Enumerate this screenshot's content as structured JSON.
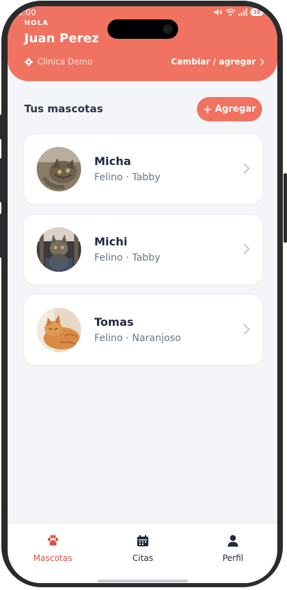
{
  "status": {
    "time": "3:00",
    "battery": "38"
  },
  "header": {
    "greeting": "HOLA",
    "user_name": "Juan Perez",
    "clinic_name": "Clinica Demo",
    "change_link": "Cambiar / agregar"
  },
  "section": {
    "title": "Tus mascotas",
    "add_button": "Agregar"
  },
  "pets": [
    {
      "name": "Micha",
      "description": "Felino · Tabby"
    },
    {
      "name": "Michi",
      "description": "Felino · Tabby"
    },
    {
      "name": "Tomas",
      "description": "Felino · Naranjoso"
    }
  ],
  "nav": {
    "items": [
      {
        "label": "Mascotas",
        "icon": "paw-icon",
        "active": true
      },
      {
        "label": "Citas",
        "icon": "calendar-icon",
        "active": false
      },
      {
        "label": "Perfil",
        "icon": "user-icon",
        "active": false
      }
    ]
  },
  "colors": {
    "accent": "#f07260",
    "active_nav": "#d9533f",
    "text_dark": "#1f2a3d",
    "background": "#f4f5f8"
  }
}
